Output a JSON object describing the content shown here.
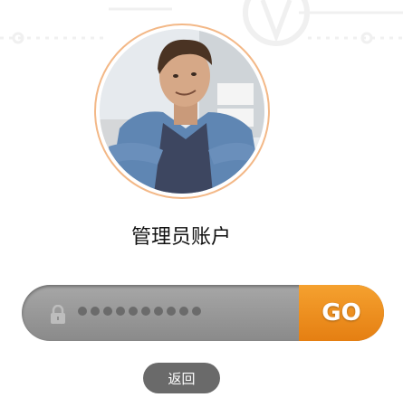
{
  "login": {
    "account_name": "管理员账户",
    "password_masked": "••••••••••",
    "password_dot_count": 10,
    "go_label": "GO",
    "back_label": "返回"
  },
  "icons": {
    "lock": "lock-icon",
    "avatar": "user-avatar-photo"
  },
  "colors": {
    "accent": "#e88b1a",
    "ring": "#f3b887",
    "input_bg": "#8f8f8f",
    "back_bg": "#6a6a6a"
  }
}
